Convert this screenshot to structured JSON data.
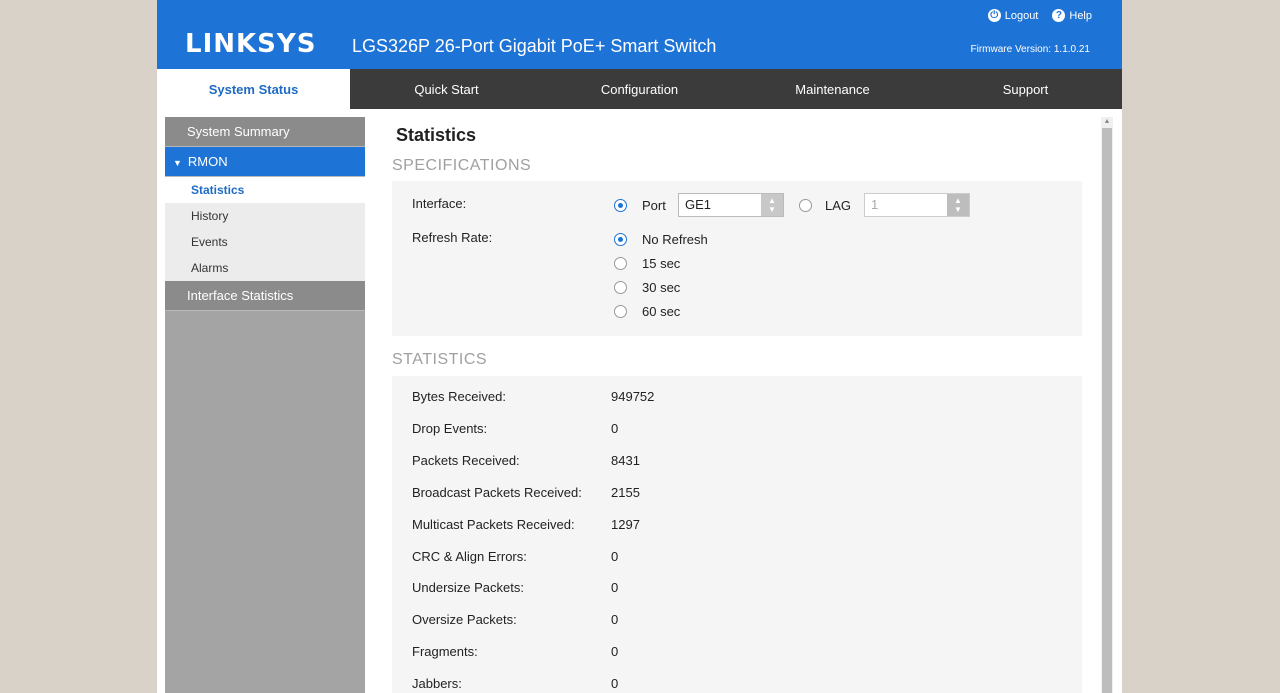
{
  "header": {
    "logo": "LINKSYS",
    "product": "LGS326P 26-Port Gigabit PoE+ Smart Switch",
    "logout": "Logout",
    "help": "Help",
    "firmware": "Firmware Version: 1.1.0.21"
  },
  "nav": {
    "tabs": [
      {
        "label": "System Status"
      },
      {
        "label": "Quick Start"
      },
      {
        "label": "Configuration"
      },
      {
        "label": "Maintenance"
      },
      {
        "label": "Support"
      }
    ]
  },
  "sidebar": {
    "system_summary": "System Summary",
    "rmon": "RMON",
    "rmon_items": [
      {
        "label": "Statistics"
      },
      {
        "label": "History"
      },
      {
        "label": "Events"
      },
      {
        "label": "Alarms"
      }
    ],
    "interface_statistics": "Interface Statistics"
  },
  "main": {
    "title": "Statistics",
    "specifications": {
      "heading": "SPECIFICATIONS",
      "interface_label": "Interface:",
      "port_label": "Port",
      "port_value": "GE1",
      "lag_label": "LAG",
      "lag_value": "1",
      "refresh_label": "Refresh Rate:",
      "refresh_options": [
        {
          "label": "No Refresh",
          "selected": true
        },
        {
          "label": "15 sec",
          "selected": false
        },
        {
          "label": "30 sec",
          "selected": false
        },
        {
          "label": "60 sec",
          "selected": false
        }
      ]
    },
    "statistics": {
      "heading": "STATISTICS",
      "rows": [
        {
          "label": "Bytes Received:",
          "value": "949752"
        },
        {
          "label": "Drop Events:",
          "value": "0"
        },
        {
          "label": "Packets Received:",
          "value": "8431"
        },
        {
          "label": "Broadcast Packets Received:",
          "value": "2155"
        },
        {
          "label": "Multicast Packets Received:",
          "value": "1297"
        },
        {
          "label": "CRC & Align Errors:",
          "value": "0"
        },
        {
          "label": "Undersize Packets:",
          "value": "0"
        },
        {
          "label": "Oversize Packets:",
          "value": "0"
        },
        {
          "label": "Fragments:",
          "value": "0"
        },
        {
          "label": "Jabbers:",
          "value": "0"
        }
      ]
    }
  },
  "colors": {
    "brand_blue": "#1e73d6",
    "nav_dark": "#3b3b3b"
  }
}
